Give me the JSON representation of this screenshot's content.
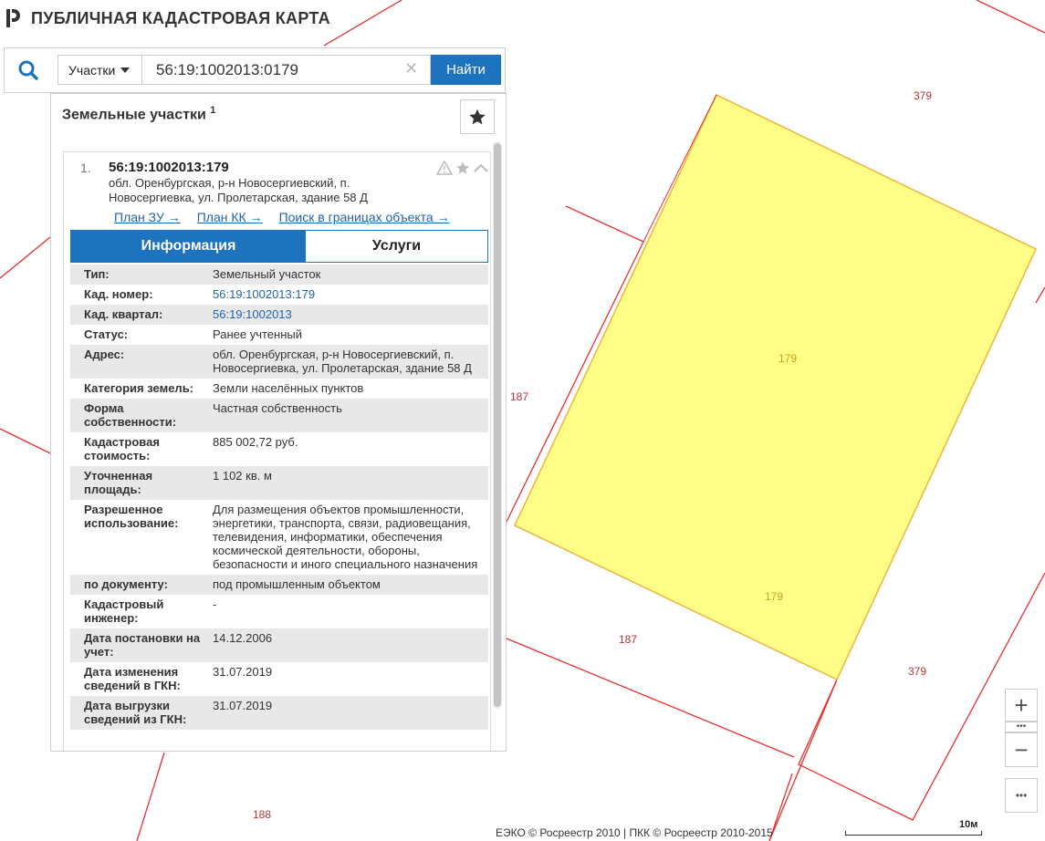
{
  "app": {
    "title": "ПУБЛИЧНАЯ КАДАСТРОВАЯ КАРТА"
  },
  "search": {
    "type_label": "Участки",
    "value": "56:19:1002013:0179",
    "find_label": "Найти"
  },
  "panel": {
    "title": "Земельные участки",
    "count": "1"
  },
  "result": {
    "index": "1.",
    "cad_number": "56:19:1002013:179",
    "address": "обл. Оренбургская, р-н Новосергиевский, п. Новосергиевка, ул. Пролетарская, здание 58 Д",
    "links": [
      "План ЗУ →",
      "План КК →",
      "Поиск в границах объекта →"
    ],
    "tabs": {
      "info": "Информация",
      "services": "Услуги"
    }
  },
  "properties": [
    {
      "label": "Тип:",
      "value": "Земельный участок"
    },
    {
      "label": "Кад. номер:",
      "value": "56:19:1002013:179",
      "link": true
    },
    {
      "label": "Кад. квартал:",
      "value": "56:19:1002013",
      "link": true
    },
    {
      "label": "Статус:",
      "value": "Ранее учтенный"
    },
    {
      "label": "Адрес:",
      "value": "обл. Оренбургская, р-н Новосергиевский, п. Новосергиевка, ул. Пролетарская, здание 58 Д"
    },
    {
      "label": "Категория земель:",
      "value": "Земли населённых пунктов"
    },
    {
      "label": "Форма собственности:",
      "value": "Частная собственность"
    },
    {
      "label": "Кадастровая стоимость:",
      "value": "885 002,72 руб."
    },
    {
      "label": "Уточненная площадь:",
      "value": "1 102 кв. м"
    },
    {
      "label": "Разрешенное использование:",
      "value": "Для размещения объектов промышленности, энергетики, транспорта, связи, радиовещания, телевидения, информатики, обеспечения космической деятельности, обороны, безопасности и иного специального назначения"
    },
    {
      "label": "по документу:",
      "value": "под промышленным объектом"
    },
    {
      "label": "Кадастровый инженер:",
      "value": "-"
    },
    {
      "label": "Дата постановки на учет:",
      "value": "14.12.2006"
    },
    {
      "label": "Дата изменения сведений в ГКН:",
      "value": "31.07.2019"
    },
    {
      "label": "Дата выгрузки сведений из ГКН:",
      "value": "31.07.2019"
    }
  ],
  "map": {
    "labels": [
      "379",
      "179",
      "187",
      "179",
      "187",
      "379",
      "188"
    ],
    "colors": {
      "parcel_fill": "#ffff88",
      "parcel_border": "#e8b64c",
      "boundary": "#e8302f",
      "label": "#b0383a"
    }
  },
  "controls": {
    "zoom_in": "+",
    "zoom_out": "−",
    "more": "•••"
  },
  "footer": {
    "copyright": "ЕЭКО © Росреестр 2010 | ПКК © Росреестр 2010-2015",
    "scale": "10м"
  }
}
